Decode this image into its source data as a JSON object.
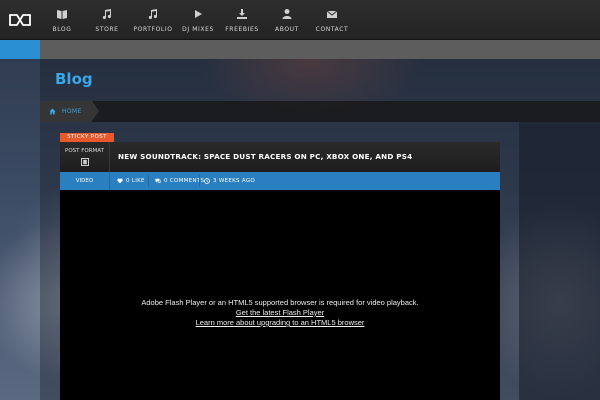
{
  "nav": {
    "logo_icon": "brand-logo-icon",
    "items": [
      {
        "label": "BLOG",
        "icon": "book-icon"
      },
      {
        "label": "STORE",
        "icon": "music-note-icon"
      },
      {
        "label": "PORTFOLIO",
        "icon": "music-note-icon"
      },
      {
        "label": "DJ MIXES",
        "icon": "play-icon"
      },
      {
        "label": "FREEBIES",
        "icon": "download-icon"
      },
      {
        "label": "ABOUT",
        "icon": "user-icon"
      },
      {
        "label": "CONTACT",
        "icon": "envelope-icon"
      }
    ]
  },
  "page": {
    "title": "Blog"
  },
  "breadcrumb": {
    "home": "HOME"
  },
  "post": {
    "sticky": "STICKY POST",
    "format_label": "POST FORMAT",
    "title": "NEW SOUNDTRACK: SPACE DUST RACERS ON PC, XBOX ONE, AND PS4",
    "meta": {
      "type": "VIDEO",
      "likes": "0 LIKE",
      "comments": "0 COMMENTS",
      "time": "3 WEEKS AGO"
    },
    "video": {
      "message": "Adobe Flash Player or an HTML5 supported browser is required for video playback.",
      "link1": "Get the latest Flash Player",
      "link2": "Learn more about upgrading to an HTML5 browser"
    }
  },
  "colors": {
    "accent": "#2b8fd3",
    "sticky": "#e8582a",
    "title": "#3aa7ea"
  }
}
